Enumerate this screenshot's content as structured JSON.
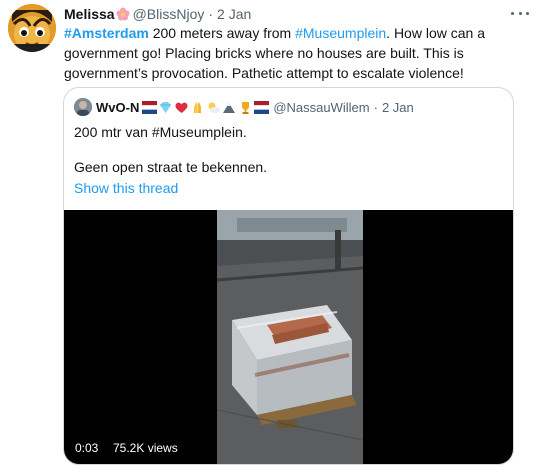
{
  "tweet": {
    "display_name": "Melissa",
    "name_emoji": "flower-emoji",
    "handle": "@BlissNjoy",
    "separator": "·",
    "time": "2 Jan",
    "hashtag_amsterdam": "#Amsterdam",
    "text_part1": " 200 meters away from ",
    "hashtag_museumplein": "#Museumplein",
    "text_part2": ". How low can a government go! Placing bricks where no houses are built. This is government’s provocation. Pathetic attempt to escalate violence!"
  },
  "quoted": {
    "display_name": "WvO-N",
    "emojis": [
      "dutch-flag",
      "diamond",
      "red-heart",
      "praying-hands",
      "sun-cloud",
      "mountain",
      "trophy",
      "dutch-flag"
    ],
    "handle": "@NassauWillem",
    "separator": "·",
    "time": "2 Jan",
    "line1": "200 mtr van #Museumplein.",
    "line2": "Geen open straat te bekennen.",
    "show_thread": "Show this thread",
    "video": {
      "duration": "0:03",
      "views": "75.2K views"
    }
  },
  "colors": {
    "accent": "#1d9bf0",
    "secondary_text": "#536471",
    "border": "#cfd9de"
  }
}
